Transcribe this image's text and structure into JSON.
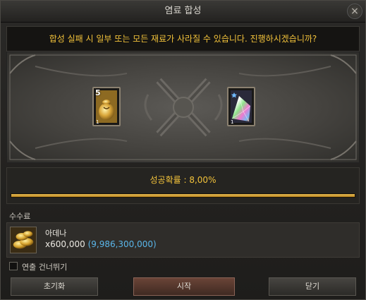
{
  "window": {
    "title": "염료 합성",
    "close_glyph": "×"
  },
  "warning": "합성 실패 시 일부 또는 모든 재료가 사라질 수 있습니다. 진행하시겠습니까?",
  "slots": {
    "left": {
      "badge": "5",
      "count": "1",
      "icon": "pouch-icon"
    },
    "right": {
      "count": "1",
      "icon": "rainbow-crystal-icon"
    }
  },
  "success": {
    "text": "성공확률 : 8,00%",
    "progress_fraction": 1.0
  },
  "fee": {
    "label": "수수료",
    "currency_name": "아데나",
    "amount": "x600,000",
    "held": "(9,986,300,000)",
    "icon": "adena-coins-icon"
  },
  "skip_effect": {
    "label": "연출 건너뛰기",
    "checked": false
  },
  "buttons": {
    "reset": "초기화",
    "start": "시작",
    "close": "닫기"
  },
  "colors": {
    "warning_text": "#f2c23a",
    "held_amount": "#5ab6ea",
    "progress_fill": "#d9a33a"
  }
}
